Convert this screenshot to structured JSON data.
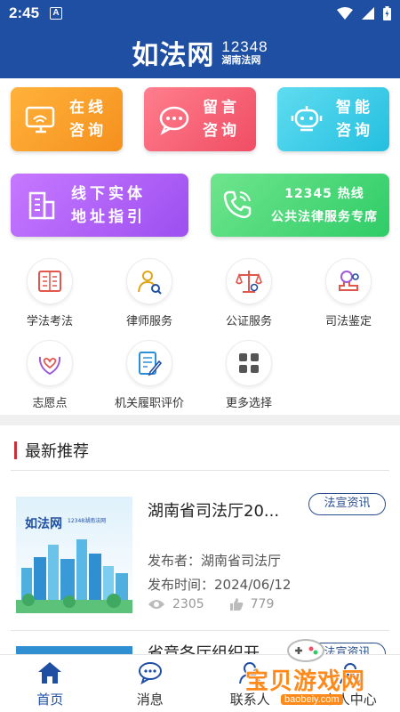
{
  "status_bar": {
    "time": "2:45",
    "app_indicator": "A"
  },
  "header": {
    "brand": "如法网",
    "hotline": "12348",
    "subtitle": "湖南法网"
  },
  "quick_cards": [
    {
      "line1": "在线",
      "line2": "咨询",
      "icon": "monitor-chat-icon"
    },
    {
      "line1": "留言",
      "line2": "咨询",
      "icon": "message-bubble-icon"
    },
    {
      "line1": "智能",
      "line2": "咨询",
      "icon": "robot-icon"
    },
    {
      "line1": "线下实体",
      "line2": "地址指引",
      "icon": "building-icon"
    },
    {
      "line1": "12345 热线",
      "line2": "公共法律服务专席",
      "icon": "phone-icon"
    }
  ],
  "services": [
    {
      "label": "学法考法",
      "icon": "book-icon"
    },
    {
      "label": "律师服务",
      "icon": "lawyer-search-icon"
    },
    {
      "label": "公证服务",
      "icon": "scales-icon"
    },
    {
      "label": "司法鉴定",
      "icon": "stamp-icon"
    },
    {
      "label": "志愿点",
      "icon": "heart-hands-icon"
    },
    {
      "label": "机关履职评价",
      "icon": "document-edit-icon"
    },
    {
      "label": "更多选择",
      "icon": "grid-icon"
    }
  ],
  "latest": {
    "section_title": "最新推荐",
    "items": [
      {
        "title": "湖南省司法厅20...",
        "tag": "法宣资讯",
        "publisher_label": "发布者：",
        "publisher": "湖南省司法厅",
        "date_label": "发布时间：",
        "date": "2024/06/12",
        "views": "2305",
        "likes": "779",
        "thumb_brand": "如法网",
        "thumb_caption": "12348湖南法网"
      },
      {
        "title": "省竞各厅组织开...",
        "tag": "法宣资讯"
      }
    ]
  },
  "bottom_nav": [
    {
      "label": "首页",
      "icon": "home-icon",
      "active": true
    },
    {
      "label": "消息",
      "icon": "chat-icon",
      "active": false
    },
    {
      "label": "联系人",
      "icon": "contacts-icon",
      "active": false
    },
    {
      "label": "个人中心",
      "icon": "user-icon",
      "active": false
    }
  ],
  "watermark": {
    "text": "宝贝游戏网",
    "url": "baobeiy.com"
  },
  "colors": {
    "primary": "#1f4fa3",
    "accent_red": "#c9303a",
    "tag_border": "#2a4f8f"
  }
}
